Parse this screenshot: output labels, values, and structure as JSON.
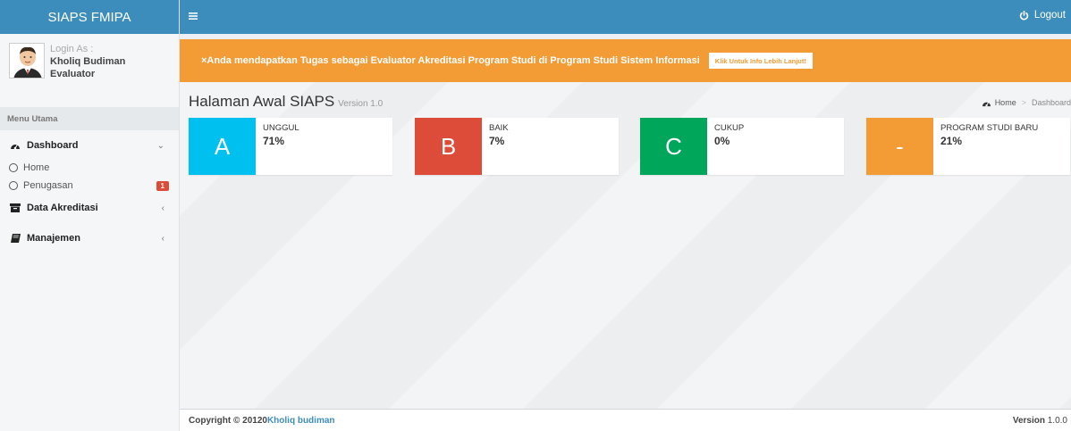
{
  "brand": {
    "title": "SIAPS FMIPA"
  },
  "user": {
    "login_as": "Login As :",
    "name": "Kholiq Budiman",
    "role": "Evaluator"
  },
  "sidebar": {
    "menu_header": "Menu Utama",
    "dashboard_label": "Dashboard",
    "sub_items": [
      {
        "label": "Home"
      },
      {
        "label": "Penugasan",
        "badge": "1"
      }
    ],
    "data_akreditasi_label": "Data Akreditasi",
    "manajemen_label": "Manajemen"
  },
  "topbar": {
    "logout_label": "Logout"
  },
  "alert": {
    "message": "×Anda mendapatkan Tugas sebagai Evaluator Akreditasi Program Studi di Program Studi Sistem Informasi",
    "button_label": "Klik Untuk Info Lebih Lanjut!"
  },
  "content": {
    "title": "Halaman Awal SIAPS",
    "version": "Version 1.0",
    "breadcrumb": {
      "home": "Home",
      "current": "Dashboard"
    }
  },
  "info_boxes": [
    {
      "letter": "A",
      "label": "UNGGUL",
      "value": "71%",
      "color": "#00c0ef"
    },
    {
      "letter": "B",
      "label": "BAIK",
      "value": "7%",
      "color": "#dd4b39"
    },
    {
      "letter": "C",
      "label": "CUKUP",
      "value": "0%",
      "color": "#00a65a"
    },
    {
      "letter": "-",
      "label": "PROGRAM STUDI BARU",
      "value": "21%",
      "color": "#f39c12"
    }
  ],
  "footer": {
    "copyright": "Copyright © 20120",
    "author": "Kholiq budiman",
    "version_label": "Version",
    "version_number": "1.0.0"
  }
}
